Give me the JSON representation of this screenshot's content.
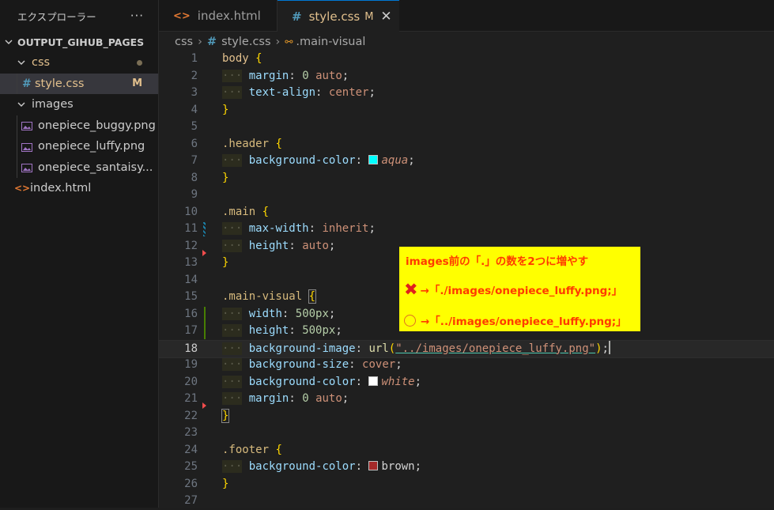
{
  "sidebar": {
    "title": "エクスプローラー",
    "more": "···",
    "section": "OUTPUT_GIHUB_PAGES",
    "items": [
      {
        "label": "css"
      },
      {
        "label": "style.css",
        "badge": "M"
      },
      {
        "label": "images"
      },
      {
        "label": "onepiece_buggy.png"
      },
      {
        "label": "onepiece_luffy.png"
      },
      {
        "label": "onepiece_santaisy..."
      },
      {
        "label": "index.html"
      }
    ]
  },
  "tabs": [
    {
      "label": "index.html"
    },
    {
      "label": "style.css",
      "badge": "M",
      "close": "✕"
    }
  ],
  "breadcrumb": {
    "folder": "css",
    "file": "style.css",
    "symbol": ".main-visual"
  },
  "editor": {
    "line_numbers": [
      "1",
      "2",
      "3",
      "4",
      "5",
      "6",
      "7",
      "8",
      "9",
      "10",
      "11",
      "12",
      "13",
      "14",
      "15",
      "16",
      "17",
      "18",
      "19",
      "20",
      "21",
      "22",
      "23",
      "24",
      "25",
      "26",
      "27"
    ],
    "active_line": "18",
    "colors": {
      "aqua": "#00ffff",
      "white": "#ffffff",
      "brown": "#a52a2a"
    }
  },
  "note": {
    "line1": "images前の「.」の数を2つに増やす",
    "line2": "→「./images/onepiece_luffy.png;」",
    "line3": "→「../images/onepiece_luffy.png;」"
  }
}
